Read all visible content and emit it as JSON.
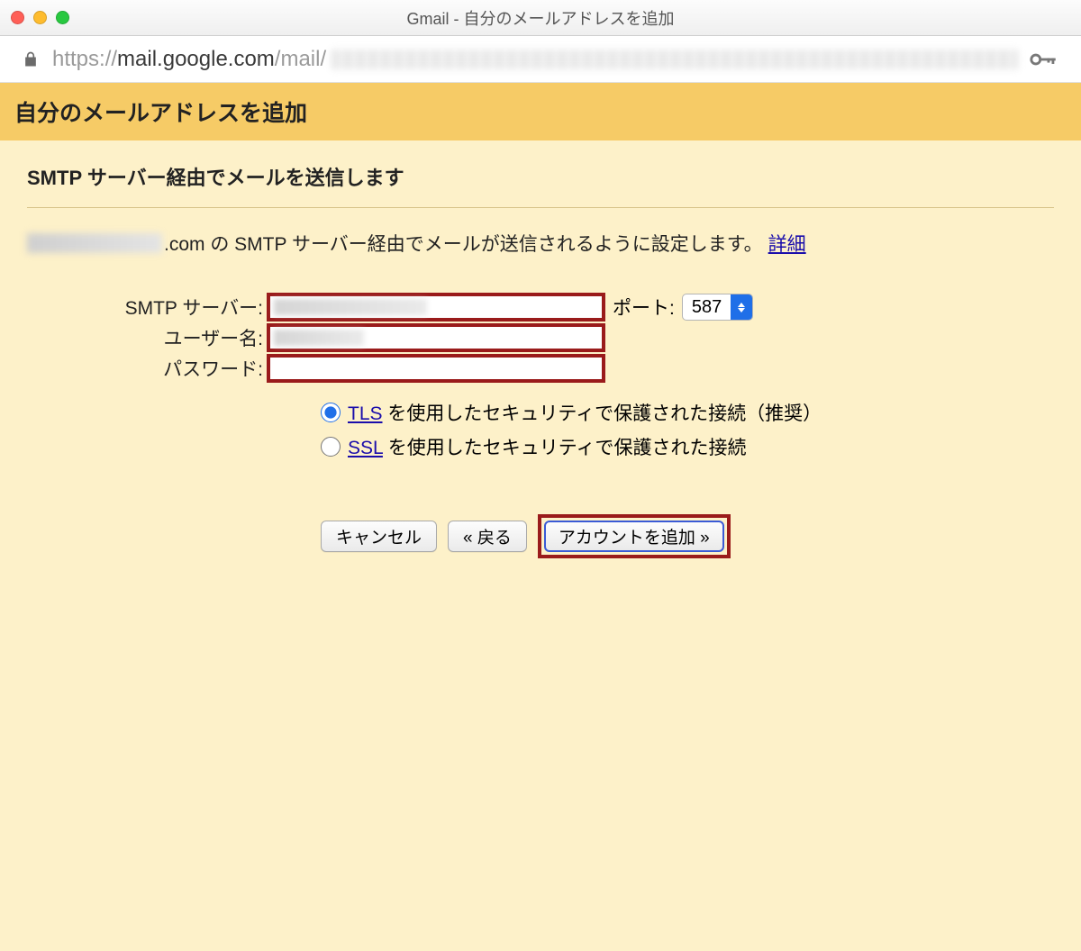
{
  "window": {
    "title": "Gmail - 自分のメールアドレスを追加"
  },
  "urlbar": {
    "scheme_prefix": "https://",
    "host": "mail.google.com",
    "path_visible": "/mail/"
  },
  "header": {
    "title": "自分のメールアドレスを追加"
  },
  "section": {
    "title": "SMTP サーバー経由でメールを送信します",
    "desc_suffix": ".com の SMTP サーバー経由でメールが送信されるように設定します。",
    "more_link": "詳細"
  },
  "form": {
    "smtp_label": "SMTP サーバー:",
    "port_label": "ポート:",
    "port_value": "587",
    "user_label": "ユーザー名:",
    "pass_label": "パスワード:"
  },
  "security": {
    "tls_link": "TLS",
    "tls_rest": " を使用したセキュリティで保護された接続（推奨）",
    "ssl_link": "SSL",
    "ssl_rest": " を使用したセキュリティで保護された接続",
    "tls_checked": true,
    "ssl_checked": false
  },
  "buttons": {
    "cancel": "キャンセル",
    "back": "« 戻る",
    "add": "アカウントを追加 »"
  }
}
